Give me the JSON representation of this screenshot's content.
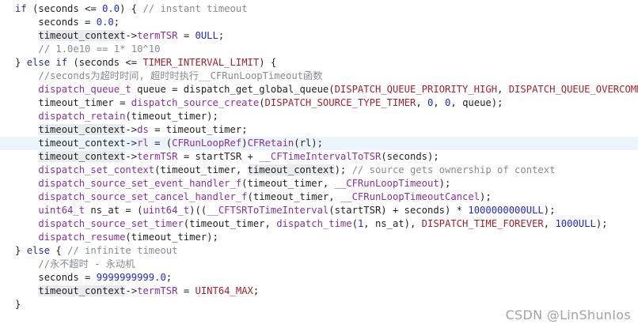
{
  "colors": {
    "keyword": "#2c2f8a",
    "comment": "#868b91",
    "number": "#2029c6",
    "function": "#8a2f9e",
    "macro": "#a3232f",
    "current_line": "#ecf4fd",
    "selection_highlight": "#e9ebef"
  },
  "code_lines": [
    {
      "indent": "",
      "tokens": [
        {
          "t": "if",
          "c": "kw"
        },
        {
          "t": " (seconds <= ",
          "c": "pl"
        },
        {
          "t": "0.0",
          "c": "num"
        },
        {
          "t": ") { ",
          "c": "pl"
        },
        {
          "t": "// instant timeout",
          "c": "cm"
        }
      ]
    },
    {
      "indent": "    ",
      "tokens": [
        {
          "t": "seconds = ",
          "c": "pl"
        },
        {
          "t": "0.0",
          "c": "num"
        },
        {
          "t": ";",
          "c": "pl"
        }
      ]
    },
    {
      "indent": "    ",
      "tokens": [
        {
          "t": "timeout_context",
          "c": "hl"
        },
        {
          "t": "->",
          "c": "pl"
        },
        {
          "t": "termTSR",
          "c": "fn"
        },
        {
          "t": " = ",
          "c": "pl"
        },
        {
          "t": "0ULL",
          "c": "num"
        },
        {
          "t": ";",
          "c": "pl"
        }
      ]
    },
    {
      "indent": "    ",
      "tokens": [
        {
          "t": "// 1.0e10 == 1* 10^10",
          "c": "cm"
        }
      ]
    },
    {
      "indent": "",
      "tokens": [
        {
          "t": "} ",
          "c": "pl"
        },
        {
          "t": "else if",
          "c": "kw"
        },
        {
          "t": " (seconds <= ",
          "c": "pl"
        },
        {
          "t": "TIMER_INTERVAL_LIMIT",
          "c": "mc"
        },
        {
          "t": ") {",
          "c": "pl"
        }
      ]
    },
    {
      "indent": "    ",
      "tokens": [
        {
          "t": "//seconds为超时时间, 超时时执行__CFRunLoopTimeout函数",
          "c": "cm"
        }
      ]
    },
    {
      "indent": "    ",
      "tokens": [
        {
          "t": "dispatch_queue_t",
          "c": "fn"
        },
        {
          "t": " queue = dispatch_get_global_queue(",
          "c": "pl"
        },
        {
          "t": "DISPATCH_QUEUE_PRIORITY_HIGH",
          "c": "mc"
        },
        {
          "t": ", ",
          "c": "pl"
        },
        {
          "t": "DISPATCH_QUEUE_OVERCOMMIT",
          "c": "mc"
        }
      ]
    },
    {
      "indent": "    ",
      "tokens": [
        {
          "t": "timeout_timer = ",
          "c": "pl"
        },
        {
          "t": "dispatch_source_create",
          "c": "fn"
        },
        {
          "t": "(",
          "c": "pl"
        },
        {
          "t": "DISPATCH_SOURCE_TYPE_TIMER",
          "c": "mc"
        },
        {
          "t": ", ",
          "c": "pl"
        },
        {
          "t": "0",
          "c": "num"
        },
        {
          "t": ", ",
          "c": "pl"
        },
        {
          "t": "0",
          "c": "num"
        },
        {
          "t": ", queue);",
          "c": "pl"
        }
      ]
    },
    {
      "indent": "    ",
      "tokens": [
        {
          "t": "dispatch_retain",
          "c": "fn"
        },
        {
          "t": "(timeout_timer);",
          "c": "pl"
        }
      ]
    },
    {
      "indent": "    ",
      "tokens": [
        {
          "t": "timeout_context",
          "c": "hl"
        },
        {
          "t": "->",
          "c": "pl"
        },
        {
          "t": "ds",
          "c": "fn"
        },
        {
          "t": " = timeout_timer;",
          "c": "pl"
        }
      ]
    },
    {
      "indent": "    ",
      "current": true,
      "tokens": [
        {
          "t": "timeout_context",
          "c": "pl"
        },
        {
          "t": "->",
          "c": "pl"
        },
        {
          "t": "rl",
          "c": "fn"
        },
        {
          "t": " = (",
          "c": "pl"
        },
        {
          "t": "CFRunLoopRef",
          "c": "fn"
        },
        {
          "t": ")",
          "c": "pl"
        },
        {
          "t": "CFRetain",
          "c": "fn"
        },
        {
          "t": "(rl);",
          "c": "pl"
        }
      ]
    },
    {
      "indent": "    ",
      "tokens": [
        {
          "t": "timeout_context",
          "c": "hl"
        },
        {
          "t": "->",
          "c": "pl"
        },
        {
          "t": "termTSR",
          "c": "fn"
        },
        {
          "t": " = startTSR + ",
          "c": "pl"
        },
        {
          "t": "__CFTimeIntervalToTSR",
          "c": "fn"
        },
        {
          "t": "(seconds);",
          "c": "pl"
        }
      ]
    },
    {
      "indent": "    ",
      "tokens": [
        {
          "t": "dispatch_set_context",
          "c": "fn"
        },
        {
          "t": "(timeout_timer, ",
          "c": "pl"
        },
        {
          "t": "timeout_context",
          "c": "hl"
        },
        {
          "t": "); ",
          "c": "pl"
        },
        {
          "t": "// source gets ownership of context",
          "c": "cm"
        }
      ]
    },
    {
      "indent": "    ",
      "tokens": [
        {
          "t": "dispatch_source_set_event_handler_f",
          "c": "fn"
        },
        {
          "t": "(timeout_timer, ",
          "c": "pl"
        },
        {
          "t": "__CFRunLoopTimeout",
          "c": "fn"
        },
        {
          "t": ");",
          "c": "pl"
        }
      ]
    },
    {
      "indent": "    ",
      "tokens": [
        {
          "t": "dispatch_source_set_cancel_handler_f",
          "c": "fn"
        },
        {
          "t": "(timeout_timer, ",
          "c": "pl"
        },
        {
          "t": "__CFRunLoopTimeoutCancel",
          "c": "fn"
        },
        {
          "t": ");",
          "c": "pl"
        }
      ]
    },
    {
      "indent": "    ",
      "tokens": [
        {
          "t": "uint64_t",
          "c": "fn"
        },
        {
          "t": " ns_at = (",
          "c": "pl"
        },
        {
          "t": "uint64_t",
          "c": "fn"
        },
        {
          "t": ")((",
          "c": "pl"
        },
        {
          "t": "__CFTSRToTimeInterval",
          "c": "fn"
        },
        {
          "t": "(startTSR) + seconds) * ",
          "c": "pl"
        },
        {
          "t": "1000000000ULL",
          "c": "num"
        },
        {
          "t": ");",
          "c": "pl"
        }
      ]
    },
    {
      "indent": "    ",
      "tokens": [
        {
          "t": "dispatch_source_set_timer",
          "c": "fn"
        },
        {
          "t": "(timeout_timer, ",
          "c": "pl"
        },
        {
          "t": "dispatch_time",
          "c": "fn"
        },
        {
          "t": "(",
          "c": "pl"
        },
        {
          "t": "1",
          "c": "num"
        },
        {
          "t": ", ns_at), ",
          "c": "pl"
        },
        {
          "t": "DISPATCH_TIME_FOREVER",
          "c": "mc"
        },
        {
          "t": ", ",
          "c": "pl"
        },
        {
          "t": "1000ULL",
          "c": "num"
        },
        {
          "t": ");",
          "c": "pl"
        }
      ]
    },
    {
      "indent": "    ",
      "tokens": [
        {
          "t": "dispatch_resume",
          "c": "fn"
        },
        {
          "t": "(timeout_timer);",
          "c": "pl"
        }
      ]
    },
    {
      "indent": "",
      "tokens": [
        {
          "t": "} ",
          "c": "pl"
        },
        {
          "t": "else",
          "c": "kw"
        },
        {
          "t": " { ",
          "c": "pl"
        },
        {
          "t": "// infinite timeout",
          "c": "cm"
        }
      ]
    },
    {
      "indent": "    ",
      "tokens": [
        {
          "t": "//永不超时 - 永动机",
          "c": "cm"
        }
      ]
    },
    {
      "indent": "    ",
      "tokens": [
        {
          "t": "seconds = ",
          "c": "pl"
        },
        {
          "t": "9999999999.0",
          "c": "num"
        },
        {
          "t": ";",
          "c": "pl"
        }
      ]
    },
    {
      "indent": "    ",
      "tokens": [
        {
          "t": "timeout_context",
          "c": "hl"
        },
        {
          "t": "->",
          "c": "pl"
        },
        {
          "t": "termTSR",
          "c": "fn"
        },
        {
          "t": " = ",
          "c": "pl"
        },
        {
          "t": "UINT64_MAX",
          "c": "mc"
        },
        {
          "t": ";",
          "c": "pl"
        }
      ]
    },
    {
      "indent": "",
      "tokens": [
        {
          "t": "}",
          "c": "pl"
        }
      ]
    }
  ],
  "watermark": "CSDN @LinShunIos"
}
